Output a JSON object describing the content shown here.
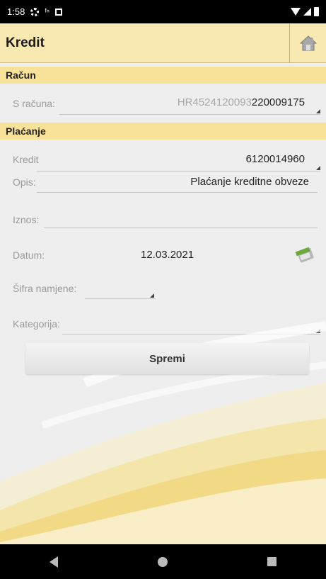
{
  "status_bar": {
    "time": "1:58"
  },
  "app_bar": {
    "title": "Kredit"
  },
  "sections": {
    "racun": "Račun",
    "placanje": "Plaćanje"
  },
  "fields": {
    "s_racuna": {
      "label": "S računa:",
      "value_prefix": "HR4524120093",
      "value_main": "220009175"
    },
    "kredit": {
      "label": "Kredit",
      "value": "6120014960"
    },
    "opis": {
      "label": "Opis:",
      "value": "Plaćanje kreditne obveze"
    },
    "iznos": {
      "label": "Iznos:",
      "value": ""
    },
    "datum": {
      "label": "Datum:",
      "value": "12.03.2021"
    },
    "sifra_namjene": {
      "label": "Šifra namjene:",
      "value": ""
    },
    "kategorija": {
      "label": "Kategorija:",
      "value": ""
    }
  },
  "buttons": {
    "save": "Spremi"
  },
  "icons": {
    "home": "home-icon",
    "calendar": "calendar-icon",
    "nav_back": "back-triangle-icon",
    "nav_home": "home-circle-icon",
    "nav_recent": "recent-square-icon"
  },
  "colors": {
    "app_bar": "#f8e9b2",
    "section_header": "#f8e29a",
    "background": "#eeeeee"
  }
}
